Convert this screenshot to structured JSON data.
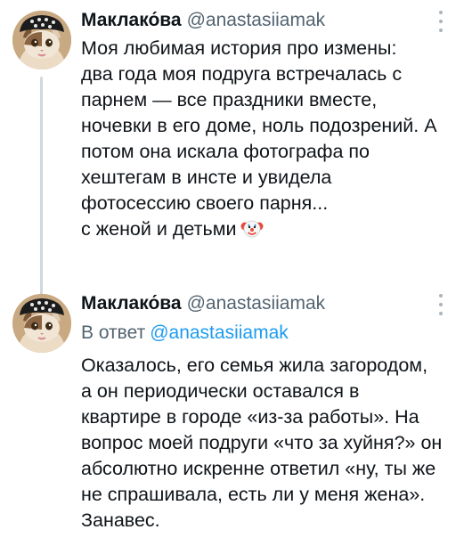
{
  "tweet1": {
    "author_name": "Маклако́ва",
    "author_handle": "@anastasiiamak",
    "body_lines": [
      "Моя любимая история про измены:",
      "два года моя подруга встречалась с",
      "парнем — все праздники вместе,",
      "ночевки в его доме, ноль подозрений. А",
      "потом она искала фотографа по",
      "хештегам в инсте и увидела",
      "фотосессию своего парня...",
      "с женой и детьми"
    ],
    "trailing_emoji": "clown-face-icon"
  },
  "tweet2": {
    "author_name": "Маклако́ва",
    "author_handle": "@anastasiiamak",
    "reply_prefix": "В ответ",
    "reply_mention": "@anastasiiamak",
    "body_lines": [
      "Оказалось, его семья жила загородом,",
      "а он периодически оставался в",
      "квартире в городе «из-за работы». На",
      "вопрос моей подруги «что за хуйня?» он",
      "абсолютно искренне ответил «ну, ты же",
      "не спрашивала, есть ли у меня жена».",
      "Занавес."
    ]
  },
  "colors": {
    "text": "#0f1419",
    "secondary": "#536471",
    "link": "#1d9bf0",
    "thread_line": "#cfd9de"
  }
}
